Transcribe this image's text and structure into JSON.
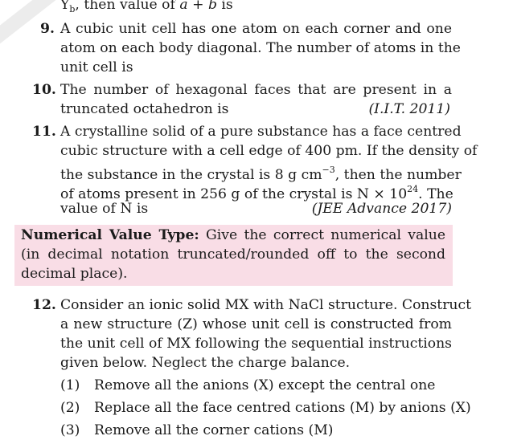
{
  "q8_tail": {
    "prefix": "Y",
    "sub": "b",
    "mid": ", then value of ",
    "var_a": "a",
    "plus": " + ",
    "var_b": "b",
    "suffix": " is"
  },
  "q9": {
    "num": "9.",
    "lines": [
      "A cubic unit cell has one atom on each corner and one",
      "atom on each body diagonal. The number of atoms in the",
      "unit cell is"
    ]
  },
  "q10": {
    "num": "10.",
    "lines": [
      "The number of hexagonal faces that are present in a",
      "truncated octahedron is"
    ],
    "source": "(I.I.T. 2011)"
  },
  "q11": {
    "num": "11.",
    "line1": "A crystalline solid of a pure substance has a face centred",
    "line2": "cubic structure with a cell edge of 400 pm. If the density of",
    "line3_a": "the substance in the crystal is 8 g cm",
    "line3_sup": "−3",
    "line3_b": ", then the number",
    "line4_a": "of atoms present in 256 g of the crystal is N × 10",
    "line4_sup": "24",
    "line4_b": ". The",
    "line5": "value of N is",
    "source": "(JEE Advance 2017)"
  },
  "numerical": {
    "heading": "Numerical Value Type:",
    "line1_rest": " Give the correct numerical value",
    "line2": "(in decimal notation truncated/rounded off to the second",
    "line3": "decimal place)."
  },
  "q12": {
    "num": "12.",
    "lines": [
      "Consider an ionic solid MX with NaCl structure. Construct",
      "a new structure (Z) whose unit cell is constructed from",
      "the unit cell of MX following the sequential instructions",
      "given below. Neglect the charge balance."
    ],
    "steps": [
      {
        "n": "(1)",
        "text": "Remove all the anions (X) except the central one"
      },
      {
        "n": "(2)",
        "text": "Replace all the face centred cations (M) by anions (X)"
      },
      {
        "n": "(3)",
        "text": "Remove all the corner cations (M)"
      }
    ]
  }
}
